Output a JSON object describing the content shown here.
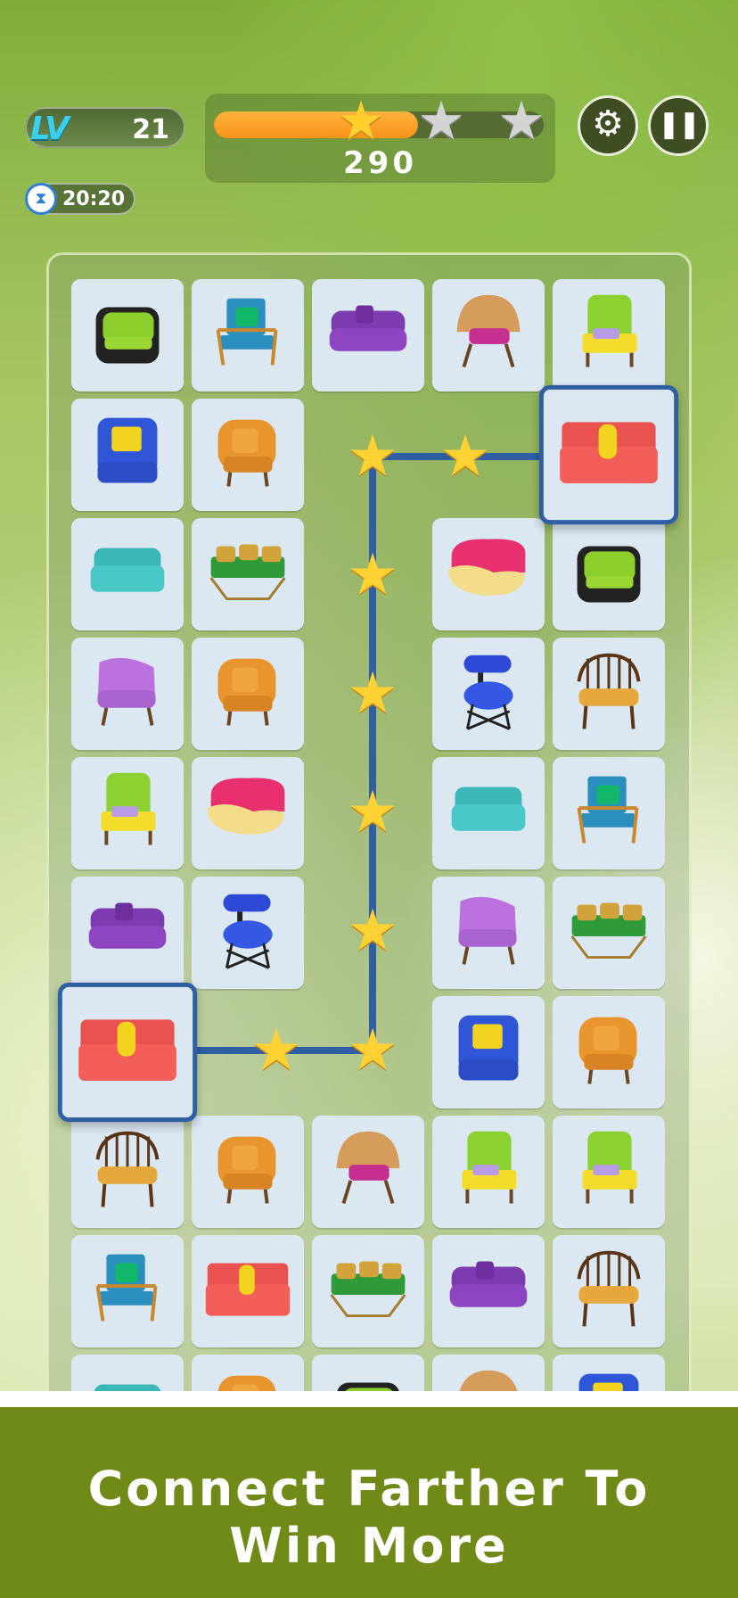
{
  "hud": {
    "level_label": "LV",
    "level_value": "21",
    "timer": "20:20",
    "score": "290",
    "progress": 0.62,
    "stars_earned": 1,
    "stars_total": 3
  },
  "colors": {
    "path": "#2f5ea3",
    "star": "#ffd233",
    "progress": "#f7931a",
    "banner": "#6f8a16"
  },
  "board": {
    "selected": [
      [
        1,
        4
      ],
      [
        6,
        0
      ]
    ],
    "empty": [
      [
        1,
        2
      ],
      [
        1,
        3
      ],
      [
        2,
        2
      ],
      [
        3,
        2
      ],
      [
        4,
        2
      ],
      [
        5,
        2
      ],
      [
        6,
        1
      ],
      [
        6,
        2
      ],
      [
        5,
        4
      ]
    ],
    "rows": [
      [
        "green-black-armchair",
        "teal-wood-armchair",
        "purple-tufted-sofa",
        "wood-shell-chair",
        "lime-wingback-chair"
      ],
      [
        "blue-swivel-armchair",
        "orange-armchair",
        "",
        "",
        "red-armchair"
      ],
      [
        "teal-armchair",
        "green-metal-sofa",
        "",
        "pink-curved-sofa",
        "green-black-armchair"
      ],
      [
        "lilac-lounge-chair",
        "orange-armchair",
        "",
        "blue-bar-stool",
        "wood-frame-chair"
      ],
      [
        "lime-wingback-chair",
        "pink-curved-sofa",
        "",
        "teal-armchair",
        "teal-wood-armchair"
      ],
      [
        "purple-tufted-sofa",
        "blue-bar-stool",
        "",
        "lilac-lounge-chair",
        "green-metal-sofa"
      ],
      [
        "red-armchair",
        "",
        "",
        "blue-swivel-armchair",
        "orange-armchair"
      ],
      [
        "wood-frame-chair",
        "orange-armchair",
        "wood-shell-chair",
        "lime-wingback-chair",
        "lime-wingback-chair"
      ],
      [
        "teal-wood-armchair",
        "red-armchair",
        "green-metal-sofa",
        "purple-tufted-sofa",
        "wood-frame-chair"
      ],
      [
        "teal-armchair",
        "orange-armchair",
        "green-black-armchair",
        "wood-shell-chair",
        "blue-swivel-armchair"
      ]
    ]
  },
  "path": {
    "stars": 8
  },
  "banner": {
    "line1": "Connect Farther To",
    "line2": "Win More"
  }
}
